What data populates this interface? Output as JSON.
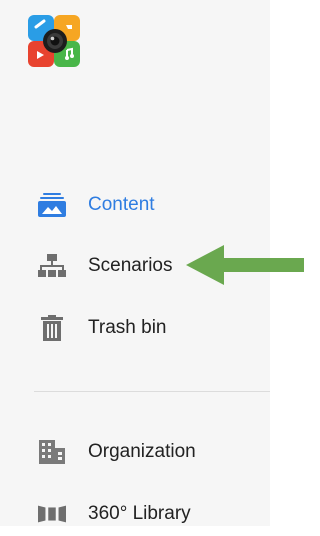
{
  "nav": {
    "items": [
      {
        "key": "content",
        "label": "Content",
        "icon": "content-icon",
        "active": true
      },
      {
        "key": "scenarios",
        "label": "Scenarios",
        "icon": "scenarios-icon",
        "active": false
      },
      {
        "key": "trash",
        "label": "Trash bin",
        "icon": "trash-icon",
        "active": false
      }
    ],
    "secondary_items": [
      {
        "key": "organization",
        "label": "Organization",
        "icon": "organization-icon"
      },
      {
        "key": "library360",
        "label": "360° Library",
        "icon": "library-360-icon"
      }
    ]
  },
  "annotation": {
    "arrow_color": "#6aa84f",
    "points_to": "Scenarios"
  },
  "colors": {
    "accent": "#2f7de1",
    "sidebar_bg": "#f6f6f6",
    "icon_gray": "#6e6e6e"
  }
}
